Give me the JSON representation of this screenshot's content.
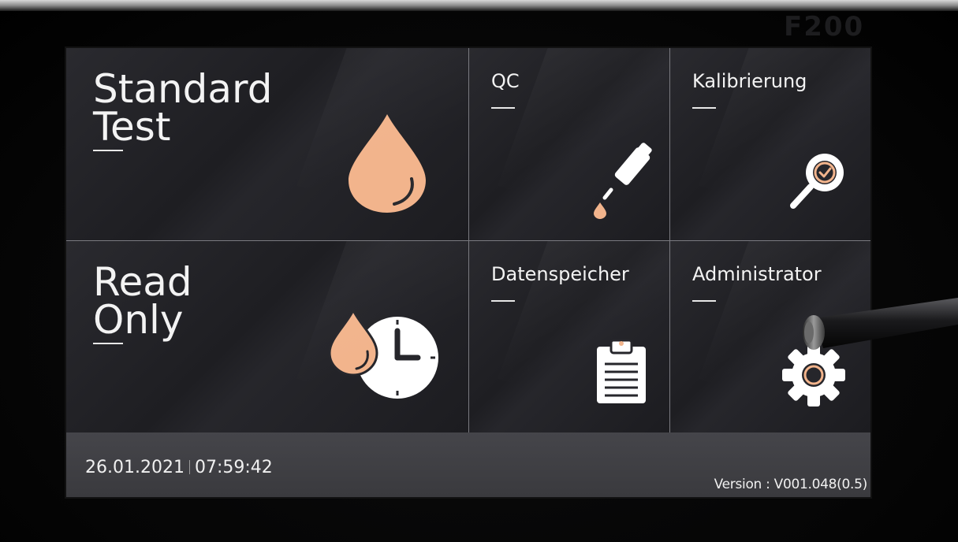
{
  "device": {
    "model": "F200"
  },
  "tiles": {
    "standard_test": {
      "label": "Standard\nTest",
      "icon": "blood-drop-icon"
    },
    "qc": {
      "label": "QC",
      "icon": "dropper-bottle-icon"
    },
    "kalibrierung": {
      "label": "Kalibrierung",
      "icon": "magnifier-check-icon"
    },
    "read_only": {
      "label": "Read\nOnly",
      "icon": "drop-clock-icon"
    },
    "datenspeicher": {
      "label": "Datenspeicher",
      "icon": "clipboard-icon"
    },
    "administrator": {
      "label": "Administrator",
      "icon": "gear-icon"
    }
  },
  "status": {
    "date": "26.01.2021",
    "time": "07:59:42",
    "version": "Version : V001.048(0.5)"
  },
  "colors": {
    "accent": "#f2b48c",
    "tile_bg": "#232327",
    "statusbar_bg": "#3f3f44",
    "text": "#f3f3f3"
  }
}
